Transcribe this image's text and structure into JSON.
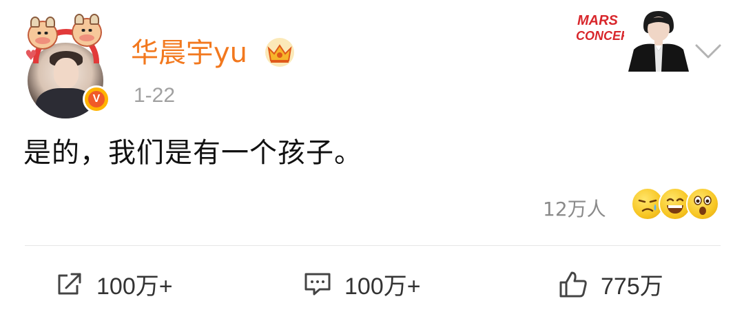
{
  "post": {
    "username": "华晨宇yu",
    "timestamp": "1-22",
    "content": "是的，我们是有一个孩子。"
  },
  "card_badge": {
    "logo_text": "MARS CONCERT"
  },
  "reactions": {
    "count": "12万人",
    "emojis": [
      "crying-face",
      "grinning-face",
      "surprised-face"
    ]
  },
  "actions": {
    "repost": "100万+",
    "comment": "100万+",
    "like": "775万"
  },
  "colors": {
    "username": "#f2781e",
    "verified_badge": "#f05a28",
    "text": "#111111",
    "meta": "#a0a0a0"
  }
}
